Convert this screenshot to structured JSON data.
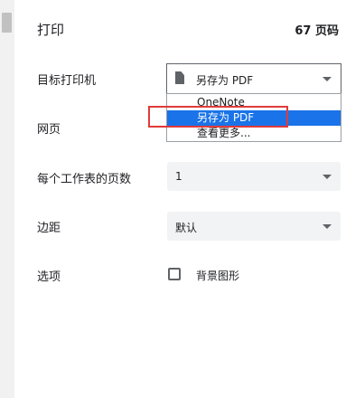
{
  "header": {
    "title": "打印",
    "page_count": "67 页码"
  },
  "destination": {
    "label": "目标打印机",
    "value": "另存为 PDF",
    "icon": "document-icon",
    "options": [
      "OneNote",
      "另存为 PDF",
      "查看更多..."
    ],
    "selected_index": 1
  },
  "pages": {
    "label": "网页"
  },
  "pages_per_sheet": {
    "label": "每个工作表的页数",
    "value": "1"
  },
  "margins": {
    "label": "边距",
    "value": "默认"
  },
  "options": {
    "label": "选项",
    "background_graphics_label": "背景图形",
    "background_graphics_checked": false
  },
  "colors": {
    "accent": "#1a73e8",
    "highlight": "#e03b3b"
  }
}
